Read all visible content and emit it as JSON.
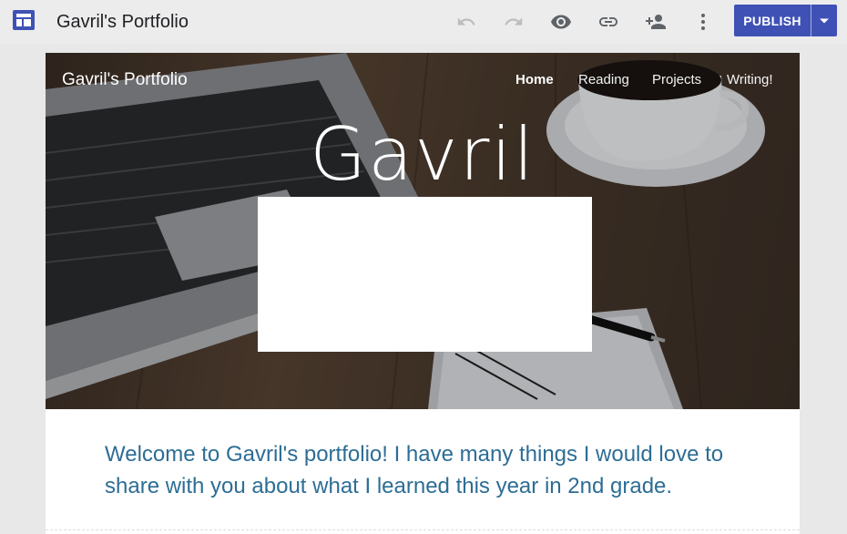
{
  "app": {
    "doc_title": "Gavril's Portfolio",
    "icons": [
      "sites-logo-icon",
      "undo-icon",
      "redo-icon",
      "preview-icon",
      "link-icon",
      "share-icon",
      "more-vert-icon",
      "dropdown-arrow-icon"
    ],
    "accent_color": "#3f51b5"
  },
  "toolbar": {
    "publish_label": "PUBLISH"
  },
  "site": {
    "name": "Gavril's Portfolio",
    "nav": [
      "Home",
      "Reading",
      "Projects",
      "Writing!"
    ],
    "active_nav": "Home",
    "hero_title": "Gavril",
    "welcome_text": "Welcome to Gavril's portfolio! I have many things I would love to share with you about what I learned this year in 2nd grade.",
    "welcome_color": "#2d6d95"
  }
}
